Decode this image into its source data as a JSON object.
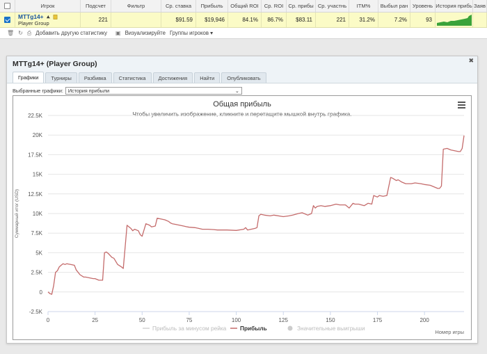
{
  "grid": {
    "headers": [
      "",
      "Игрок",
      "Подсчет",
      "Фильтр",
      "Ср. ставка",
      "Прибыль",
      "Общий ROI",
      "Ср. ROI",
      "Ср. прибы",
      "Ср. участнь",
      "ITM%",
      "Выбыл ран",
      "Уровень",
      "История прибь",
      "Заяв"
    ],
    "row": {
      "player": "MTTg14+",
      "group": "Player Group",
      "count": "221",
      "filter": "",
      "avg_stake": "$91.59",
      "profit": "$19,946",
      "total_roi": "84.1%",
      "avg_roi": "86.7%",
      "avg_profit": "$83.11",
      "avg_entrants": "221",
      "itm": "31.2%",
      "early_out": "7.2%",
      "level": "93"
    }
  },
  "toolbar": {
    "add_stats": "Добавить другую статистику",
    "visualize": "Визуализируйте",
    "player_groups": "Группы игроков"
  },
  "panel": {
    "title": "MTTg14+ (Player Group)",
    "tabs": [
      "Графики",
      "Турниры",
      "Разбивка",
      "Статистика",
      "Достижения",
      "Найти",
      "Опубликовать"
    ],
    "select_label": "Выбранные графики:",
    "select_value": "История прибыли"
  },
  "chart_data": {
    "type": "line",
    "title": "Общая прибыль",
    "subtitle": "Чтобы увеличить изображение, кликните и перетащите мышкой внутрь графика.",
    "xlabel": "Номер игры",
    "ylabel": "Суммарный итог (USD)",
    "xlim": [
      0,
      221
    ],
    "ylim": [
      -2500,
      22500
    ],
    "xticks": [
      0,
      25,
      50,
      75,
      100,
      125,
      150,
      175,
      200
    ],
    "yticks": [
      -2500,
      0,
      2500,
      5000,
      7500,
      10000,
      12500,
      15000,
      17500,
      20000,
      22500
    ],
    "ytick_labels": [
      "-2.5K",
      "0",
      "2.5K",
      "5K",
      "7.5K",
      "10K",
      "12.5K",
      "15K",
      "17.5K",
      "20K",
      "22.5K"
    ],
    "grid": true,
    "legend_position": "bottom",
    "legend": [
      {
        "name": "Прибыль за минусом рейка",
        "color": "#cccccc",
        "visible": false
      },
      {
        "name": "Прибыль",
        "color": "#c46b6b",
        "visible": true
      },
      {
        "name": "Значительные выигрыши",
        "color": "#cccccc",
        "visible": false
      }
    ],
    "series": [
      {
        "name": "Прибыль",
        "color": "#c46b6b",
        "x": [
          0,
          1,
          2,
          3,
          4,
          5,
          6,
          7,
          8,
          9,
          10,
          12,
          14,
          15,
          17,
          19,
          20,
          22,
          24,
          25,
          27,
          29,
          30,
          31,
          32,
          34,
          35,
          37,
          39,
          40,
          42,
          43,
          44,
          45,
          46,
          48,
          49,
          50,
          52,
          54,
          55,
          57,
          58,
          60,
          62,
          64,
          65,
          66,
          68,
          70,
          72,
          74,
          75,
          78,
          80,
          82,
          85,
          88,
          90,
          95,
          100,
          104,
          105,
          106,
          110,
          111,
          112,
          113,
          115,
          118,
          120,
          125,
          128,
          130,
          133,
          135,
          138,
          140,
          141,
          142,
          143,
          145,
          147,
          150,
          153,
          155,
          158,
          160,
          162,
          163,
          165,
          168,
          170,
          172,
          173,
          175,
          176,
          178,
          180,
          182,
          183,
          185,
          186,
          188,
          190,
          193,
          195,
          198,
          200,
          203,
          205,
          207,
          208,
          209,
          210,
          212,
          214,
          216,
          218,
          219,
          220,
          221
        ],
        "y": [
          0,
          -200,
          -300,
          800,
          2500,
          2700,
          3200,
          3400,
          3600,
          3500,
          3600,
          3500,
          3400,
          2800,
          2200,
          1900,
          1900,
          1800,
          1700,
          1700,
          1500,
          1500,
          5000,
          5100,
          4900,
          4400,
          4300,
          3500,
          3200,
          3000,
          8500,
          8300,
          8100,
          7800,
          8000,
          7800,
          7300,
          7100,
          8700,
          8500,
          8300,
          8400,
          9400,
          9300,
          9200,
          9000,
          8800,
          8700,
          8600,
          8500,
          8400,
          8300,
          8250,
          8200,
          8100,
          8000,
          8000,
          7950,
          7900,
          7900,
          7850,
          8000,
          8200,
          7900,
          8100,
          8200,
          9700,
          9900,
          9800,
          9700,
          9800,
          9600,
          9700,
          9800,
          10000,
          10100,
          9800,
          10000,
          11000,
          10700,
          10900,
          11000,
          10900,
          11000,
          11200,
          11100,
          11100,
          10700,
          11300,
          11200,
          11200,
          11000,
          11300,
          11200,
          12300,
          12100,
          12300,
          12200,
          12300,
          14600,
          14500,
          14200,
          14300,
          14000,
          13800,
          13800,
          13900,
          13800,
          13700,
          13600,
          13400,
          13200,
          13200,
          13500,
          18200,
          18300,
          18100,
          18000,
          17900,
          17900,
          18300,
          19946
        ]
      }
    ]
  }
}
